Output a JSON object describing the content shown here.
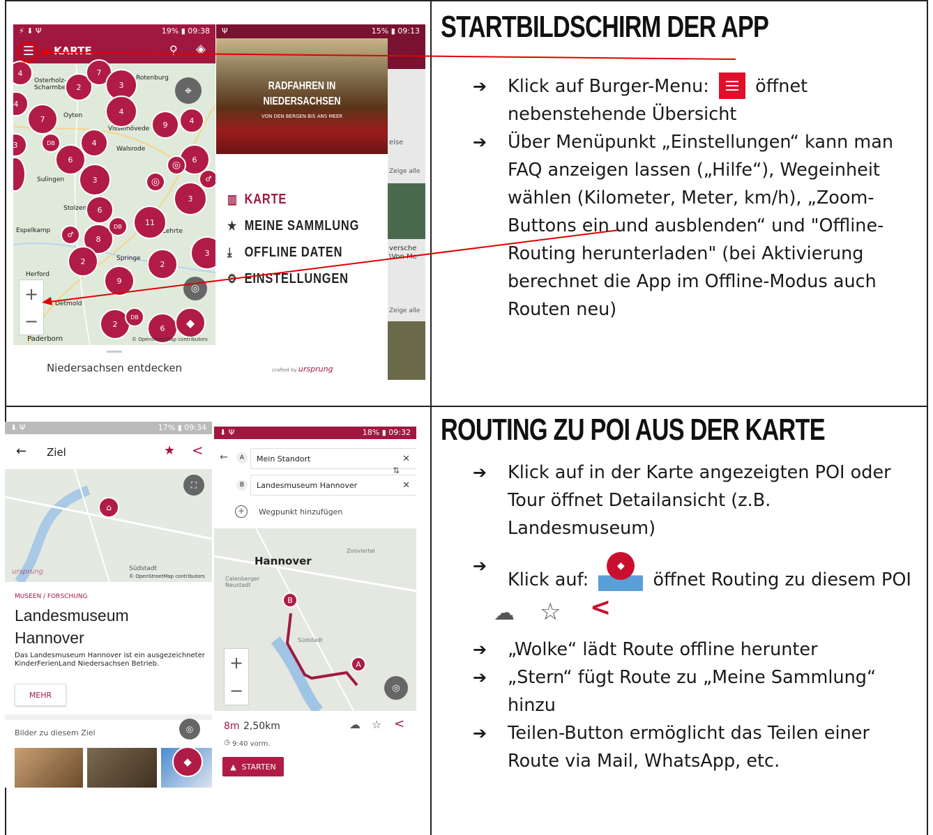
{
  "sections": [
    {
      "heading": "Startbildschirm der App",
      "bullets": [
        "Klick auf Burger-Menu:",
        "öffnet nebenstehende Übersicht",
        "Über Menüpunkt „Einstellungen“ kann man FAQ anzeigen lassen („Hilfe“), Wegeinheit wählen (Kilometer, Meter, km/h), „Zoom-Buttons ein und ausblenden“ und \"Offline-Routing herunterladen\" (bei Aktivierung berechnet die App im Offline-Modus auch Routen neu)"
      ]
    },
    {
      "heading": "Routing zu POI aus der Karte",
      "bullets": [
        "Klick auf in der Karte angezeigten POI oder Tour öffnet Detailansicht (z.B. Landesmuseum)",
        "Klick auf:",
        "öffnet Routing zu diesem POI",
        "„Wolke“ lädt Route offline herunter",
        "„Stern“ fügt Route zu „Meine Sammlung“ hinzu",
        "Teilen-Button ermöglicht das Teilen einer Route via Mail, WhatsApp, etc."
      ]
    }
  ],
  "screen1": {
    "status_left": "⚡ ⬇ Ψ",
    "status_right": "19% ▮ 09:38",
    "title": "KARTE",
    "places": [
      "Osterholz-Scharmbeck",
      "Oyten",
      "Visselhövede",
      "Walsrode",
      "Sulingen",
      "Stolzenau",
      "Espelkamp",
      "Lehrte",
      "Springe",
      "Herford",
      "Detmold",
      "Paderborn",
      "Rotenburg"
    ],
    "clusters": [
      "4",
      "2",
      "7",
      "3",
      "4",
      "7",
      "4",
      "9",
      "4",
      "3",
      "6",
      "3",
      "4",
      "6",
      "11",
      "3",
      "6",
      "8",
      "2",
      "9",
      "2",
      "2",
      "6",
      "3"
    ],
    "footer": "Niedersachsen entdecken",
    "map_credit": "© OpenStreetMap contributors"
  },
  "screen2": {
    "status_right": "15% ▮ 09:13",
    "banner_line1": "RADFAHREN IN",
    "banner_line2": "NIEDERSACHSEN",
    "banner_line3": "VON DEN BERGEN BIS ANS MEER",
    "menu": [
      "KARTE",
      "MEINE SAMMLUNG",
      "OFFLINE DATEN",
      "EINSTELLUNGEN"
    ],
    "peek": [
      "eise",
      "Zeige alle",
      "versche",
      "\\Von Me",
      "Zeige alle"
    ],
    "footer_small": "crafted by",
    "footer_brand": "ursprung"
  },
  "screen3": {
    "status_right": "17% ▮ 09:34",
    "title": "Ziel",
    "map_label": "Südstadt",
    "map_credit": "© OpenStreetMap contributors",
    "map_brand": "ursprung",
    "category": "MUSEEN / FORSCHUNG",
    "name": "Landesmuseum Hannover",
    "desc": "Das Landesmuseum Hannover ist ein ausgezeichneter KinderFerienLand Niedersachsen Betrieb.",
    "more": "MEHR",
    "pictures": "Bilder zu diesem Ziel"
  },
  "screen4": {
    "status_right": "18% ▮ 09:32",
    "from": "Mein Standort",
    "to": "Landesmuseum Hannover",
    "add": "Wegpunkt hinzufügen",
    "city": "Hannover",
    "zoo": "Zooviertel",
    "calen": "Calenberger Neustadt",
    "south": "Südstadt",
    "stats_time": "8m",
    "stats_dist": "2,50km",
    "arrival": "9:40 vorm.",
    "start": "STARTEN",
    "markerA": "A",
    "markerB": "B"
  },
  "colors": {
    "brand": "#b01c46",
    "arrow": "#e00000",
    "map": "#dfeadb"
  }
}
